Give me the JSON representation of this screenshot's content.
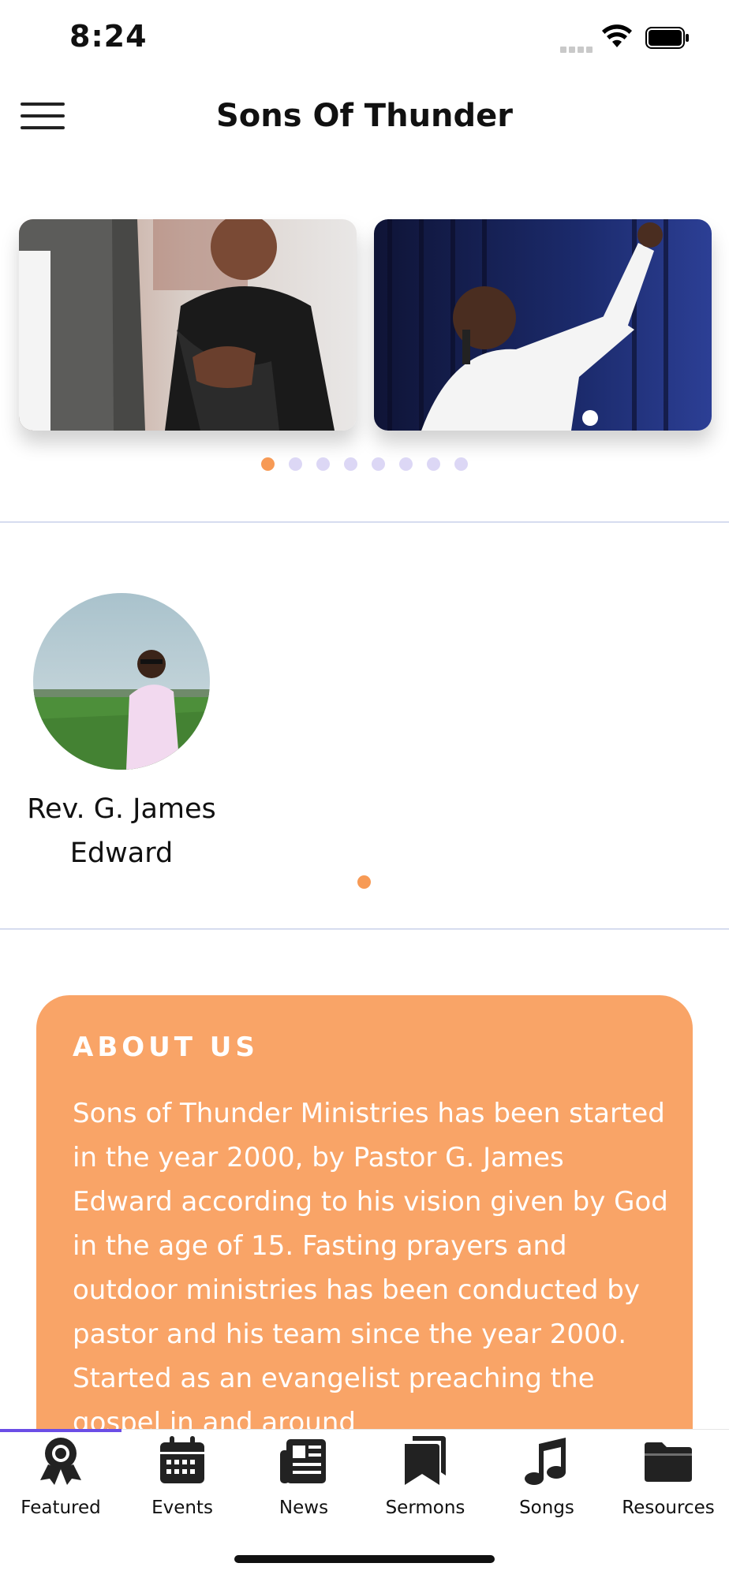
{
  "status_bar": {
    "time": "8:24"
  },
  "header": {
    "title": "Sons Of Thunder"
  },
  "carousel": {
    "slides": [
      {
        "icon": "couple-photo"
      },
      {
        "icon": "preacher-photo"
      }
    ],
    "dot_count": 8,
    "active_index": 0
  },
  "leaders": {
    "items": [
      {
        "name": "Rev. G. James Edward",
        "icon": "portrait-photo"
      }
    ],
    "active_index": 0
  },
  "about": {
    "title": "ABOUT US",
    "text": "Sons of Thunder Ministries has been started in the year 2000, by Pastor G. James Edward according to his vision given by God in the age of 15. Fasting prayers and outdoor ministries has been conducted by pastor and his team since the year 2000. Started as an evangelist preaching the gospel in and around"
  },
  "tabbar": {
    "active": "Featured",
    "accent": "#6b4ee6",
    "tabs": [
      {
        "label": "Featured",
        "icon": "award-icon"
      },
      {
        "label": "Events",
        "icon": "calendar-icon"
      },
      {
        "label": "News",
        "icon": "newspaper-icon"
      },
      {
        "label": "Sermons",
        "icon": "bookmarks-icon"
      },
      {
        "label": "Songs",
        "icon": "music-note-icon"
      },
      {
        "label": "Resources",
        "icon": "folder-icon"
      }
    ]
  },
  "colors": {
    "accent_orange": "#f79a55",
    "card_orange": "#f9a467",
    "dot_inactive": "#dcd7f5",
    "divider": "#d6dcef"
  }
}
